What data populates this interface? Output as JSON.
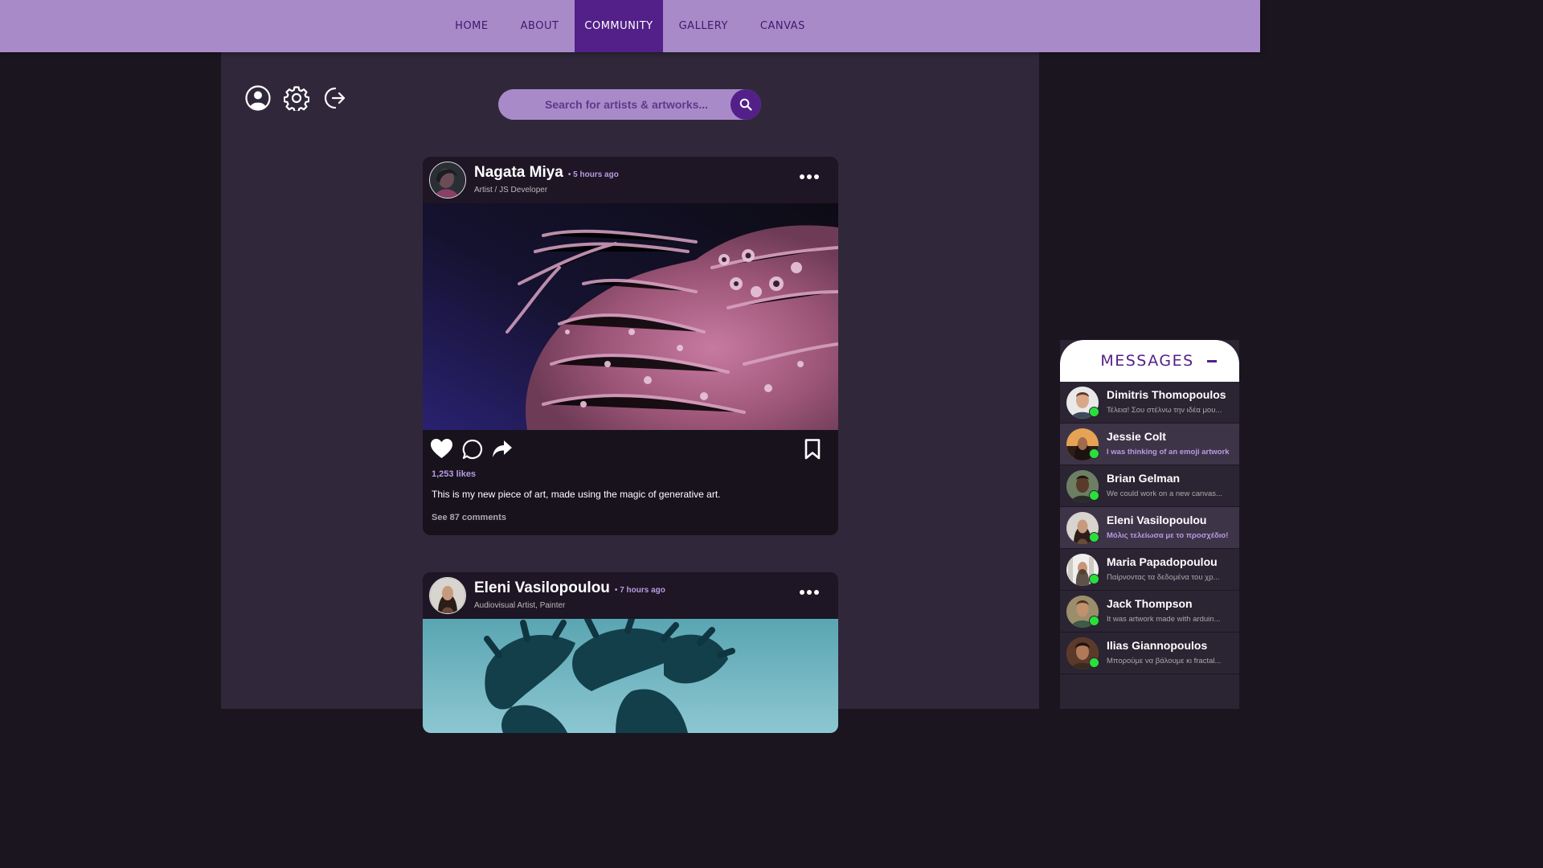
{
  "nav": {
    "items": [
      "HOME",
      "ABOUT",
      "COMMUNITY",
      "GALLERY",
      "CANVAS"
    ],
    "active": "COMMUNITY"
  },
  "toolbar": {
    "icons": [
      "user-profile-icon",
      "settings-gear-icon",
      "logout-icon"
    ]
  },
  "search": {
    "placeholder": "Search for artists & artworks...",
    "value": ""
  },
  "posts": [
    {
      "author": "Nagata Miya",
      "time": "• 5 hours ago",
      "role": "Artist / JS Developer",
      "likes": "1,253 likes",
      "caption": "This is my new piece of art, made using the magic of generative art.",
      "comments": "See 87 comments"
    },
    {
      "author": "Eleni Vasilopoulou",
      "time": "• 7 hours ago",
      "role": "Audiovisual Artist, Painter"
    }
  ],
  "messages": {
    "title": "MESSAGES",
    "items": [
      {
        "name": "Dimitris Thomopoulos",
        "text": "Τέλεια! Σου στέλνω την ιδέα μου...",
        "unread": false
      },
      {
        "name": "Jessie Colt",
        "text": "I was thinking of an emoji artwork",
        "unread": true
      },
      {
        "name": "Brian Gelman",
        "text": "We could work on a new canvas...",
        "unread": false
      },
      {
        "name": "Eleni Vasilopoulou",
        "text": "Μόλις τελείωσα με το προσχέδιο!",
        "unread": true
      },
      {
        "name": "Maria Papadopoulou",
        "text": "Παίρνοντας τα δεδομένα του χρ...",
        "unread": false
      },
      {
        "name": "Jack Thompson",
        "text": "It was artwork made with arduin...",
        "unread": false
      },
      {
        "name": "Ilias Giannopoulos",
        "text": "Μπορούμε να βάλουμε κι fractal...",
        "unread": false
      }
    ]
  },
  "colors": {
    "nav_bg": "#a98ac9",
    "accent": "#531f88",
    "online": "#29e03a",
    "highlight_text": "#b89be0"
  }
}
